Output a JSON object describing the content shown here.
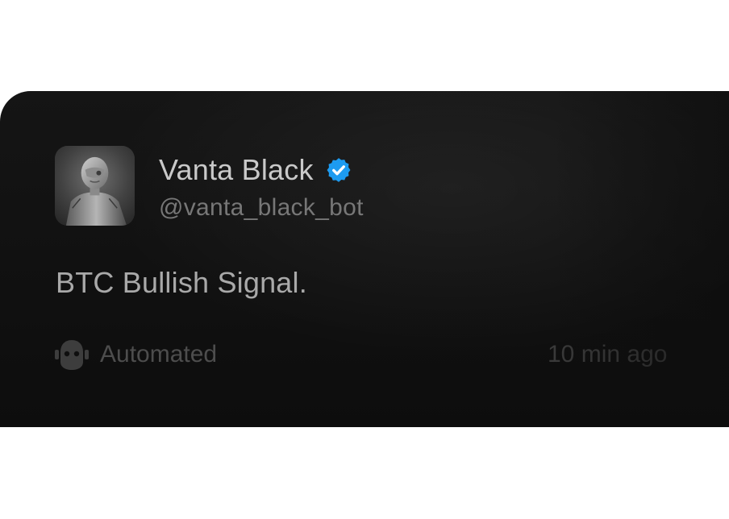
{
  "post": {
    "author_name": "Vanta Black",
    "handle": "@vanta_black_bot",
    "verified": true,
    "message": "BTC Bullish Signal.",
    "automated_label": "Automated",
    "timestamp": "10 min ago"
  },
  "icons": {
    "avatar": "robot-avatar-image",
    "verified": "verified-badge-icon",
    "automated": "robot-icon"
  },
  "colors": {
    "card_background": "#111111",
    "verified_badge": "#1d9bf0",
    "name_text": "#c9c9c9",
    "handle_text": "#777777",
    "message_text": "#a9a9a9",
    "footer_text": "#4d4d4d"
  }
}
